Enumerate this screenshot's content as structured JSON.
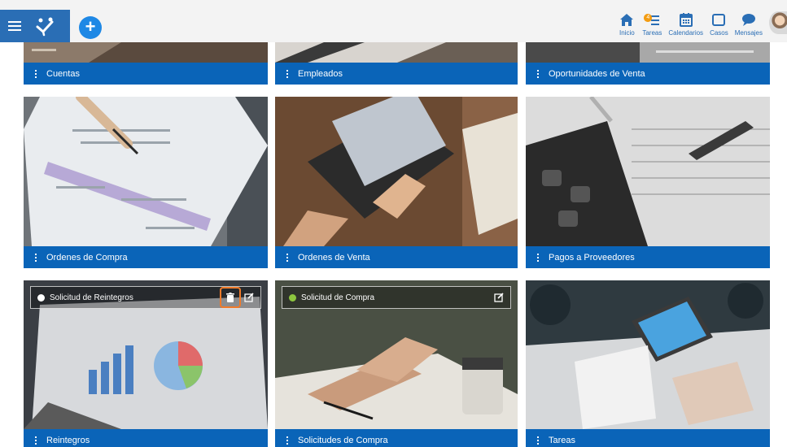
{
  "header": {
    "menu_icon": "hamburger-icon",
    "logo_icon": "logo-icon",
    "add_icon": "plus-icon",
    "nav": [
      {
        "label": "Inicio",
        "icon": "home-icon"
      },
      {
        "label": "Tareas",
        "icon": "tasks-icon",
        "badge": "4"
      },
      {
        "label": "Calendarios",
        "icon": "calendar-icon"
      },
      {
        "label": "Casos",
        "icon": "cases-icon"
      },
      {
        "label": "Mensajes",
        "icon": "message-icon"
      }
    ]
  },
  "tiles": [
    {
      "title": "Cuentas"
    },
    {
      "title": "Empleados"
    },
    {
      "title": "Oportunidades de Venta"
    },
    {
      "title": "Ordenes de Compra"
    },
    {
      "title": "Ordenes de Venta"
    },
    {
      "title": "Pagos a Proveedores"
    },
    {
      "title": "Reintegros",
      "overlay_title": "Solicitud de Reintegros",
      "status_color": "#ffffff"
    },
    {
      "title": "Solicitudes de Compra",
      "overlay_title": "Solicitud de Compra",
      "status_color": "#8dc63f"
    },
    {
      "title": "Tareas"
    }
  ],
  "colors": {
    "accent": "#0a64b8",
    "header_bg": "#f3f3f3",
    "highlight": "#f07a2a"
  }
}
